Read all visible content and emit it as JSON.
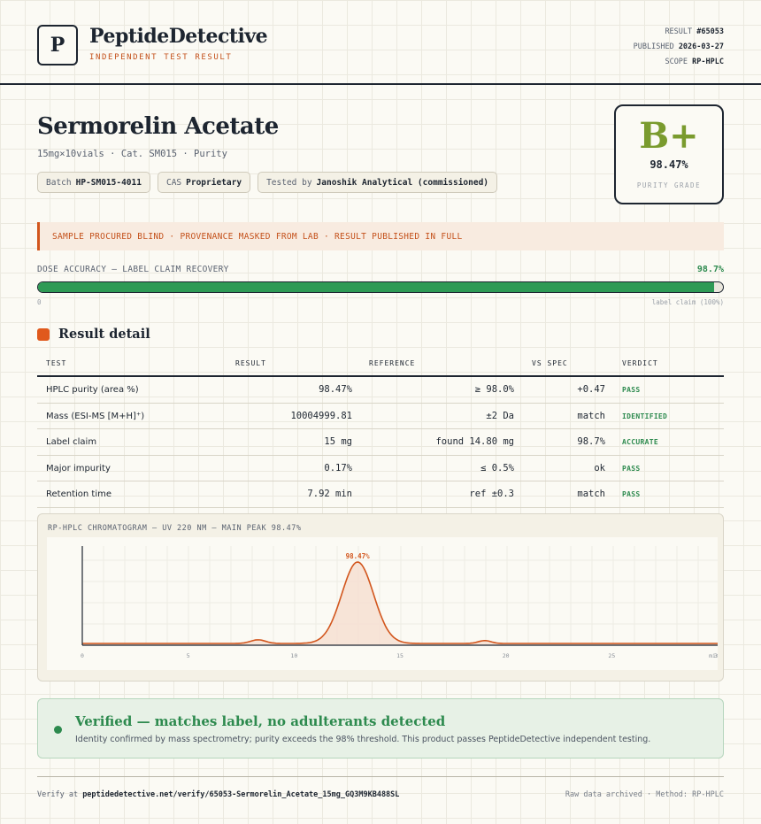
{
  "header": {
    "logo_letter": "P",
    "brand": "PeptideDetective",
    "tagline": "INDEPENDENT TEST RESULT",
    "meta": {
      "result_label": "RESULT",
      "result_value": "#65053",
      "published_label": "PUBLISHED",
      "published_value": "2026-03-27",
      "scope_label": "SCOPE",
      "scope_value": "RP-HPLC"
    }
  },
  "product": {
    "name": "Sermorelin Acetate",
    "subtitle": "15mg×10vials · Cat. SM015 · Purity",
    "chips": [
      {
        "label": "Batch",
        "value": "HP-SM015-4011"
      },
      {
        "label": "CAS",
        "value": "Proprietary"
      },
      {
        "label": "Tested by",
        "value": "Janoshik Analytical (commissioned)"
      }
    ]
  },
  "grade": {
    "letter": "B+",
    "value": "98.47%",
    "label": "PURITY GRADE",
    "color": "#7a9b2e"
  },
  "banner": {
    "text": "SAMPLE PROCURED BLIND · PROVENANCE MASKED FROM LAB · RESULT PUBLISHED IN FULL"
  },
  "dose": {
    "label": "DOSE ACCURACY — LABEL CLAIM RECOVERY",
    "value_text": "98.7%",
    "fraction": 0.987,
    "min_label": "0",
    "max_label": "label claim (100%)",
    "color": "#2e9a55"
  },
  "results": {
    "section_title": "Result detail",
    "columns": [
      "TEST",
      "RESULT",
      "REFERENCE",
      "VS SPEC",
      "VERDICT"
    ],
    "rows": [
      {
        "test": "HPLC purity (area %)",
        "result": "98.47%",
        "reference": "≥ 98.0%",
        "vs_spec": "+0.47",
        "verdict": "PASS"
      },
      {
        "test": "Mass (ESI-MS [M+H]⁺)",
        "result": "10004999.81",
        "reference": "±2 Da",
        "vs_spec": "match",
        "verdict": "IDENTIFIED"
      },
      {
        "test": "Label claim",
        "result": "15 mg",
        "reference": "found 14.80 mg",
        "vs_spec": "98.7%",
        "verdict": "ACCURATE"
      },
      {
        "test": "Major impurity",
        "result": "0.17%",
        "reference": "≤ 0.5%",
        "vs_spec": "ok",
        "verdict": "PASS"
      },
      {
        "test": "Retention time",
        "result": "7.92 min",
        "reference": "ref ±0.3",
        "vs_spec": "match",
        "verdict": "PASS"
      }
    ]
  },
  "chromatogram": {
    "title": "RP-HPLC CHROMATOGRAM — UV 220 NM — MAIN PEAK 98.47%"
  },
  "chart_data": {
    "type": "line",
    "title": "RP-HPLC CHROMATOGRAM — UV 220 NM — MAIN PEAK 98.47%",
    "xlabel": "",
    "ylabel": "",
    "xlim": [
      0,
      30
    ],
    "x_ticks": [
      "0",
      "5",
      "10",
      "15",
      "20",
      "25",
      "30"
    ],
    "x_tick_values": [
      0,
      5,
      10,
      15,
      20,
      25,
      30
    ],
    "x_unit": "min",
    "peaks": [
      {
        "center": 8.3,
        "height": 0.045,
        "width": 0.35
      },
      {
        "center": 13.0,
        "height": 1.0,
        "width": 0.75
      },
      {
        "center": 19.0,
        "height": 0.035,
        "width": 0.3
      }
    ],
    "peak_label": "98.47%",
    "color": "#d2561d",
    "grid": true
  },
  "verified": {
    "title": "Verified — matches label, no adulterants detected",
    "description": "Identity confirmed by mass spectrometry; purity exceeds the 98% threshold. This product passes PeptideDetective independent testing.",
    "color": "#2d8a4e"
  },
  "footer": {
    "verify_prefix": "Verify at",
    "verify_url": "peptidedetective.net/verify/65053-Sermorelin_Acetate_15mg_GQ3M9KB488SL",
    "right_text": "Raw data archived · Method: RP-HPLC"
  }
}
